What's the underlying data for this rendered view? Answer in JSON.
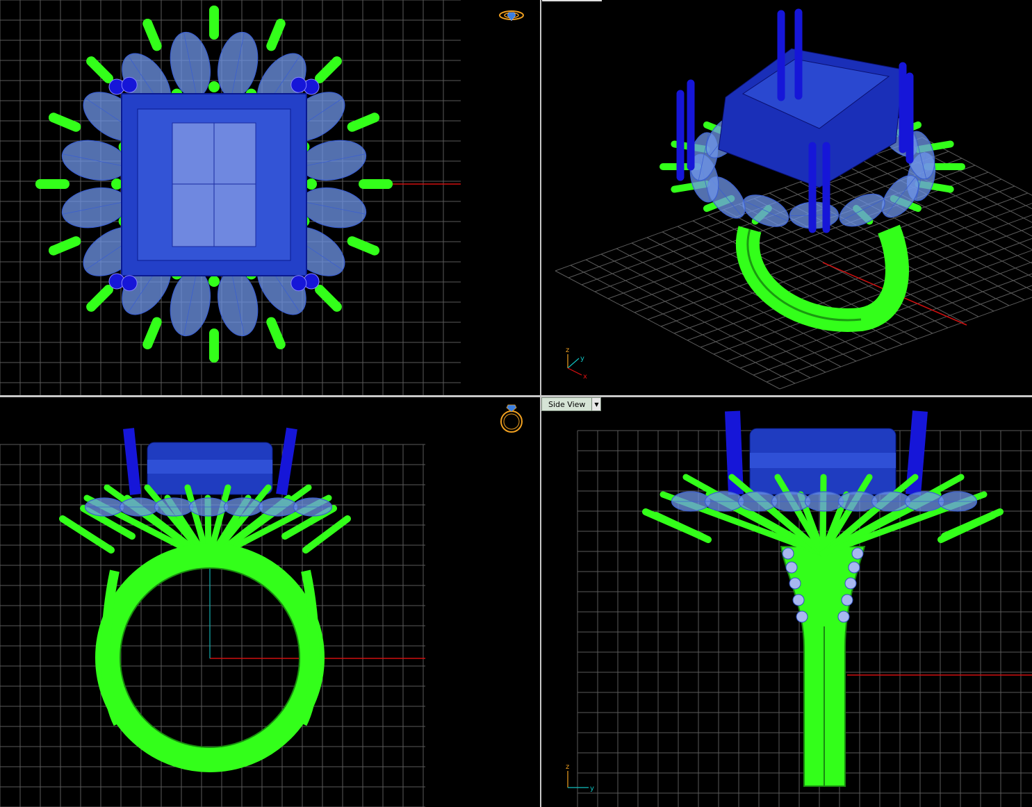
{
  "viewports": {
    "top": {},
    "perspective": {
      "axis_labels": {
        "z": "z",
        "y": "y",
        "x": "x"
      }
    },
    "front": {},
    "side": {
      "view_label": "Side View",
      "axis_labels": {
        "z": "z",
        "y": "y"
      }
    }
  },
  "colors": {
    "grid": "#5a5a5a",
    "metal": "#33ff1a",
    "gem_center": "#1e3cc8",
    "gem_side": "#6f95e8",
    "prong_blue": "#1616d8",
    "axis_x": "#e01010",
    "axis_y": "#10c0c0",
    "widget": "#f0a020"
  },
  "icons": {
    "top_view_widget": "ring-top-view-icon",
    "front_view_widget": "ring-front-view-icon",
    "dropdown": "chevron-down-icon"
  }
}
